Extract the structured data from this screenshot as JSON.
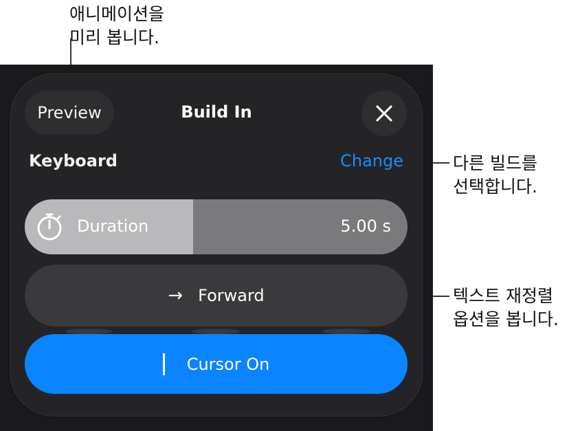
{
  "callouts": {
    "preview": [
      "애니메이션을",
      "미리 봅니다."
    ],
    "change": [
      "다른 빌드를",
      "선택합니다."
    ],
    "forward": [
      "텍스트 재정렬",
      "옵션을 봅니다."
    ]
  },
  "panel": {
    "preview_label": "Preview",
    "title": "Build In",
    "close_icon": "close-icon"
  },
  "build": {
    "name": "Keyboard",
    "change_label": "Change"
  },
  "duration": {
    "label": "Duration",
    "value": "5.00 s",
    "fill_fraction": 0.44,
    "icon": "timer-icon"
  },
  "direction": {
    "arrow": "→",
    "label": "Forward"
  },
  "cursor": {
    "label": "Cursor On"
  },
  "colors": {
    "accent": "#0a84ff",
    "link": "#1a8cff",
    "panel_bg": "#242426",
    "screen_bg": "#1a1a1c"
  }
}
